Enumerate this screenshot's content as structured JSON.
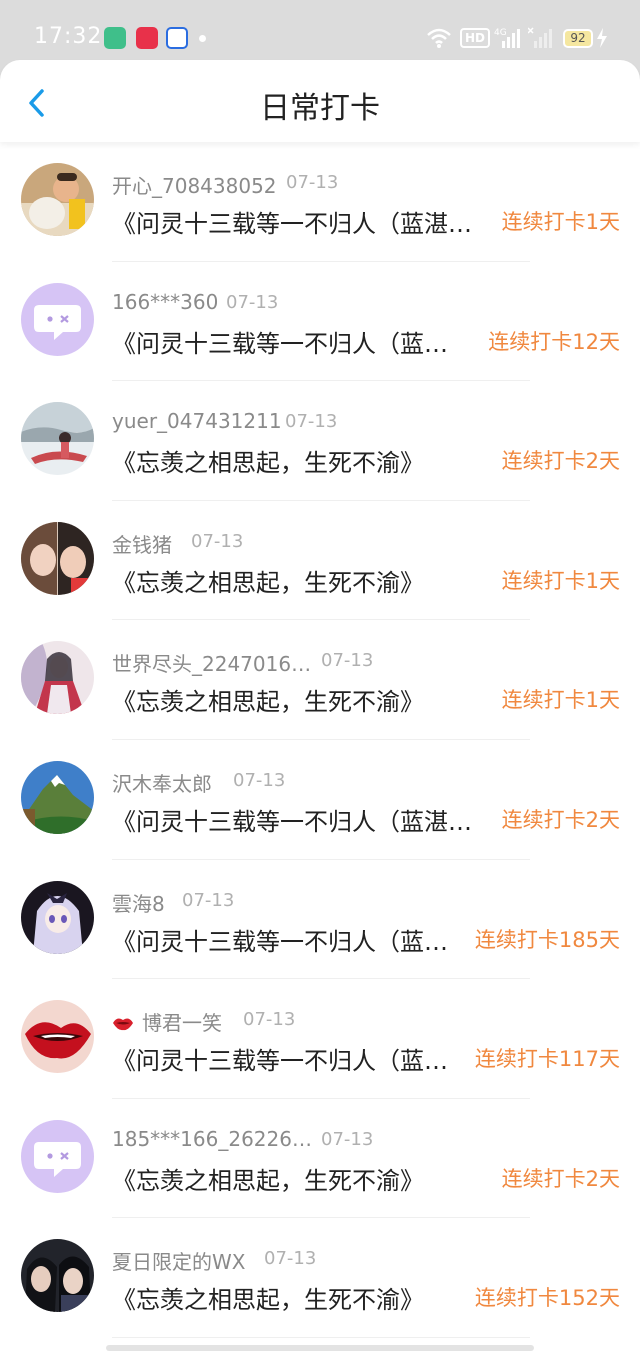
{
  "status_bar": {
    "time": "17:32",
    "network": "4G",
    "battery": "92",
    "hd_label": "HD"
  },
  "header": {
    "title": "日常打卡",
    "back_icon": "chevron-left-icon",
    "accent_color": "#1a9be8"
  },
  "entries": [
    {
      "name": "开心_708438052",
      "date": "07-13",
      "book": "《问灵十三载等一不归人（蓝湛篇…",
      "streak": "连续打卡1天",
      "avatar": "photo-child"
    },
    {
      "name": "166***360",
      "date": "07-13",
      "book": "《问灵十三载等一不归人（蓝湛…",
      "streak": "连续打卡12天",
      "avatar": "default-chat"
    },
    {
      "name": "yuer_047431211",
      "date": "07-13",
      "book": "《忘羡之相思起，生死不渝》",
      "streak": "连续打卡2天",
      "avatar": "photo-snow"
    },
    {
      "name": "金钱猪",
      "date": "07-13",
      "book": "《忘羡之相思起，生死不渝》",
      "streak": "连续打卡1天",
      "avatar": "photo-selfie"
    },
    {
      "name": "世界尽头_2247016…",
      "date": "07-13",
      "book": "《忘羡之相思起，生死不渝》",
      "streak": "连续打卡1天",
      "avatar": "photo-painting"
    },
    {
      "name": "沢木奉太郎",
      "date": "07-13",
      "book": "《问灵十三载等一不归人（蓝湛篇…",
      "streak": "连续打卡2天",
      "avatar": "photo-mountain"
    },
    {
      "name": "雲海8",
      "date": "07-13",
      "book": "《问灵十三载等一不归人（蓝湛…",
      "streak": "连续打卡185天",
      "avatar": "photo-anime"
    },
    {
      "name": "博君一笑",
      "date": "07-13",
      "book": "《问灵十三载等一不归人（蓝湛…",
      "streak": "连续打卡117天",
      "avatar": "photo-lips",
      "badge": "lips-icon"
    },
    {
      "name": "185***166_26226…",
      "date": "07-13",
      "book": "《忘羡之相思起，生死不渝》",
      "streak": "连续打卡2天",
      "avatar": "default-chat"
    },
    {
      "name": "夏日限定的WX",
      "date": "07-13",
      "book": "《忘羡之相思起，生死不渝》",
      "streak": "连续打卡152天",
      "avatar": "photo-duo"
    }
  ],
  "colors": {
    "streak": "#f0883f",
    "name": "#8a8a8a",
    "default_avatar": "#d6c4f5"
  }
}
